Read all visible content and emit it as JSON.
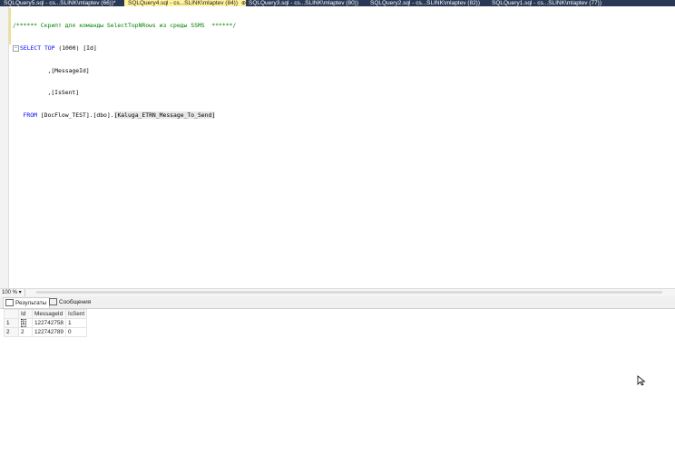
{
  "tabs": [
    {
      "label": "SQLQuery5.sql - cs...SLINK\\mlaptev (66))*",
      "active": false
    },
    {
      "label": "SQLQuery4.sql - cs...SLINK\\mlaptev (84))",
      "active": true,
      "pin": "⊕",
      "close": "✕"
    },
    {
      "label": "SQLQuery3.sql - cs...SLINK\\mlaptev (80))",
      "active": false
    },
    {
      "label": "SQLQuery2.sql - cs...SLINK\\mlaptev (82))",
      "active": false
    },
    {
      "label": "SQLQuery1.sql - cs...SLINK\\mlaptev (77))",
      "active": false
    }
  ],
  "editor": {
    "comment": "/****** Скрипт для команды SelectTopNRows из среды SSMS  ******/",
    "select_kw": "SELECT",
    "top_kw": "TOP",
    "top_value": "(1000)",
    "col1": "[Id]",
    "col2": ",[MessageId]",
    "col3": ",[IsSent]",
    "from_kw": "FROM",
    "schema": "[DocFlow_TEST].[dbo].",
    "table": "[Kaluga_ETRN_Message_To_Send]"
  },
  "zoom": "100 %",
  "results_tabs": [
    {
      "label": "Результаты",
      "icon": "grid-icon",
      "active": true
    },
    {
      "label": "Сообщения",
      "icon": "message-icon",
      "active": false
    }
  ],
  "grid": {
    "columns": [
      "Id",
      "MessageId",
      "IsSent"
    ],
    "rows": [
      {
        "num": "1",
        "id": "1",
        "message_id": "122742758",
        "is_sent": "1"
      },
      {
        "num": "2",
        "id": "2",
        "message_id": "122742789",
        "is_sent": "0"
      }
    ]
  },
  "colors": {
    "tab_strip": "#293955",
    "active_tab": "#fff29d",
    "keyword": "#0000ff",
    "comment": "#008000"
  }
}
